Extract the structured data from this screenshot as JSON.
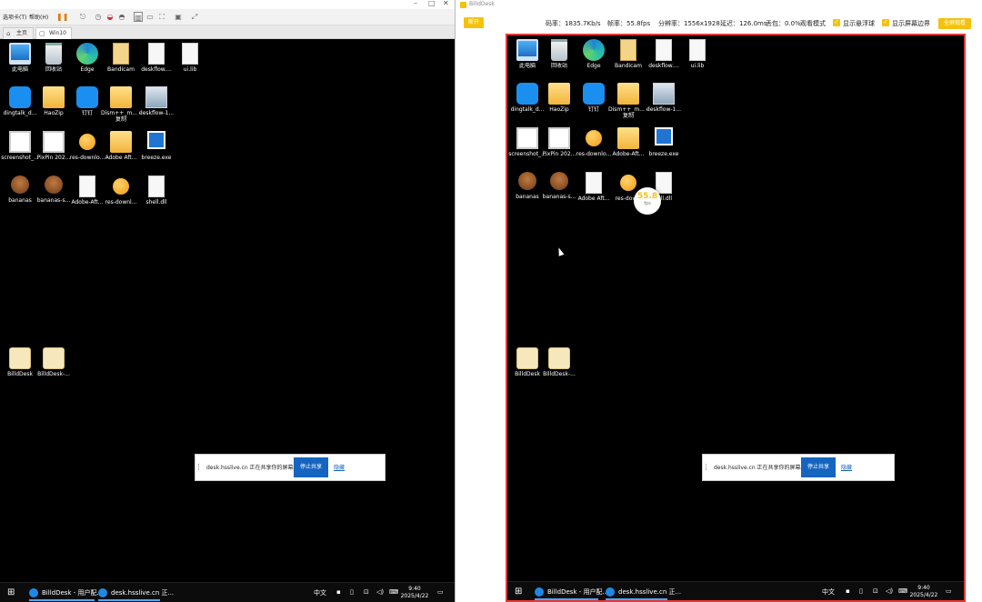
{
  "left_window": {
    "title_controls": {
      "minimize": "–",
      "maximize": "□",
      "close": "✕"
    },
    "menu": {
      "tabs_menu": "选项卡(T)",
      "help_menu": "帮助(H)"
    },
    "tabs": [
      {
        "label": "主页"
      },
      {
        "label": "Win10"
      }
    ]
  },
  "desktop": {
    "icons": [
      {
        "label": "此电脑",
        "icon": "computer-icon"
      },
      {
        "label": "回收站",
        "icon": "recycle-bin-icon"
      },
      {
        "label": "Edge",
        "icon": "edge-icon"
      },
      {
        "label": "Bandicam",
        "icon": "file-icon"
      },
      {
        "label": "deskflow....",
        "icon": "file-icon"
      },
      {
        "label": "ui.lib",
        "icon": "file-icon"
      },
      {
        "label": "dingtalk_d...",
        "icon": "dingtalk-icon"
      },
      {
        "label": "HaoZip",
        "icon": "folder-icon"
      },
      {
        "label": "钉钉",
        "icon": "dingtalk-icon"
      },
      {
        "label": "Dism++_m... - 复制",
        "icon": "folder-icon"
      },
      {
        "label": "deskflow-1...",
        "icon": "computer-icon"
      },
      {
        "label": "screenshot_...",
        "icon": "screenshot-icon"
      },
      {
        "label": "PixPin 202...",
        "icon": "screenshot-icon"
      },
      {
        "label": "res-downlo...",
        "icon": "orange-icon"
      },
      {
        "label": "Adobe Aft...",
        "icon": "folder-icon"
      },
      {
        "label": "breeze.exe",
        "icon": "breeze-icon"
      },
      {
        "label": "bananas",
        "icon": "monkey-icon"
      },
      {
        "label": "bananas-s...",
        "icon": "monkey-icon"
      },
      {
        "label": "Adobe-Aft...",
        "icon": "file-icon"
      },
      {
        "label": "res-downl...",
        "icon": "orange-icon"
      },
      {
        "label": "shell.dll",
        "icon": "file-icon"
      },
      {
        "label": "BilldDesk",
        "icon": "billddesk-icon"
      },
      {
        "label": "BilldDesk-...",
        "icon": "billddesk-icon"
      }
    ],
    "right_icons": [
      {
        "label": "此电脑"
      },
      {
        "label": "回收站"
      },
      {
        "label": "Edge"
      },
      {
        "label": "Bandicam"
      },
      {
        "label": "deskflow...."
      },
      {
        "label": "ui.lib"
      },
      {
        "label": "dingtalk_d..."
      },
      {
        "label": "HaoZip"
      },
      {
        "label": "钉钉"
      },
      {
        "label": "Dism++_m... - 复制"
      },
      {
        "label": "deskflow-1..."
      },
      {
        "label": "screenshot_..."
      },
      {
        "label": "PixPin 202..."
      },
      {
        "label": "res-downlo..."
      },
      {
        "label": "Adobe-Aft..."
      },
      {
        "label": "breeze.exe"
      },
      {
        "label": "bananas"
      },
      {
        "label": "bananas-s..."
      },
      {
        "label": "Adobe Aft..."
      },
      {
        "label": "res-dow..."
      },
      {
        "label": "...ll.dll"
      },
      {
        "label": "BilldDesk"
      },
      {
        "label": "BilldDesk-..."
      }
    ],
    "share_banner": {
      "left_text": "desk.hsslive.cn 正在共享你的屏幕。",
      "right_text": "desk.hsslive.cn 正在共享你的屏幕。",
      "stop_label": "停止共享",
      "hide_label": "隐藏"
    },
    "taskbar": {
      "app1": "BilldDesk - 用户配...",
      "app2": "desk.hsslive.cn 正...",
      "system_text": "中文",
      "time": "9:40",
      "date": "2025/4/22"
    }
  },
  "right_window": {
    "title": "BilldDesk",
    "left_button": "断开",
    "stats": {
      "bitrate": "码率：1835.7Kb/s",
      "framerate": "帧率：55.8fps",
      "resolution": "分辨率：1556x1928",
      "latency": "延迟：126.0ms",
      "loss": "丢包：0.0%"
    },
    "mode_label": "观看模式",
    "options": [
      {
        "label": "显示悬浮球"
      },
      {
        "label": "显示屏幕边界"
      }
    ],
    "right_button": "全屏观看",
    "fps_badge": {
      "value": "55.8",
      "unit": "fps"
    }
  },
  "colors": {
    "accent": "#f4c20d",
    "border_red": "#e53935",
    "stop_blue": "#1565c0"
  }
}
